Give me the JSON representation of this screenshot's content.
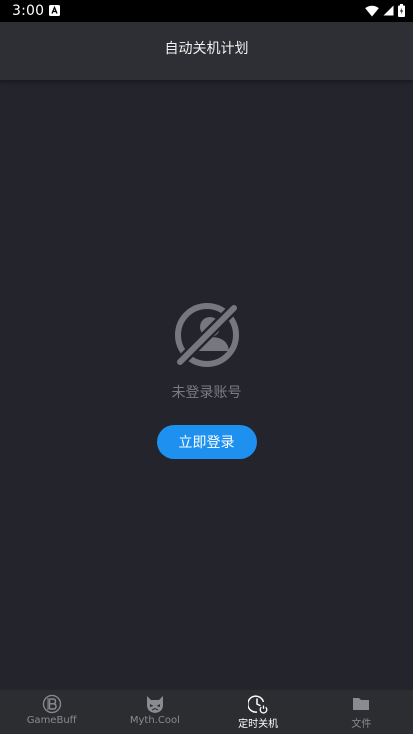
{
  "status_bar": {
    "time": "3:00"
  },
  "app_bar": {
    "title": "自动关机计划"
  },
  "empty_state": {
    "message": "未登录账号",
    "login_button": "立即登录"
  },
  "bottom_nav": {
    "items": [
      {
        "label": "GameBuff",
        "icon": "gamebuff-icon",
        "active": false
      },
      {
        "label": "Myth.Cool",
        "icon": "myth-cool-icon",
        "active": false
      },
      {
        "label": "定时关机",
        "icon": "timer-power-icon",
        "active": true
      },
      {
        "label": "文件",
        "icon": "folder-icon",
        "active": false
      }
    ]
  },
  "colors": {
    "background": "#23242c",
    "app_bar": "#2e2f34",
    "accent": "#1e90f0",
    "nav_bar": "#2c2d31",
    "muted_text": "#7b7c82"
  }
}
